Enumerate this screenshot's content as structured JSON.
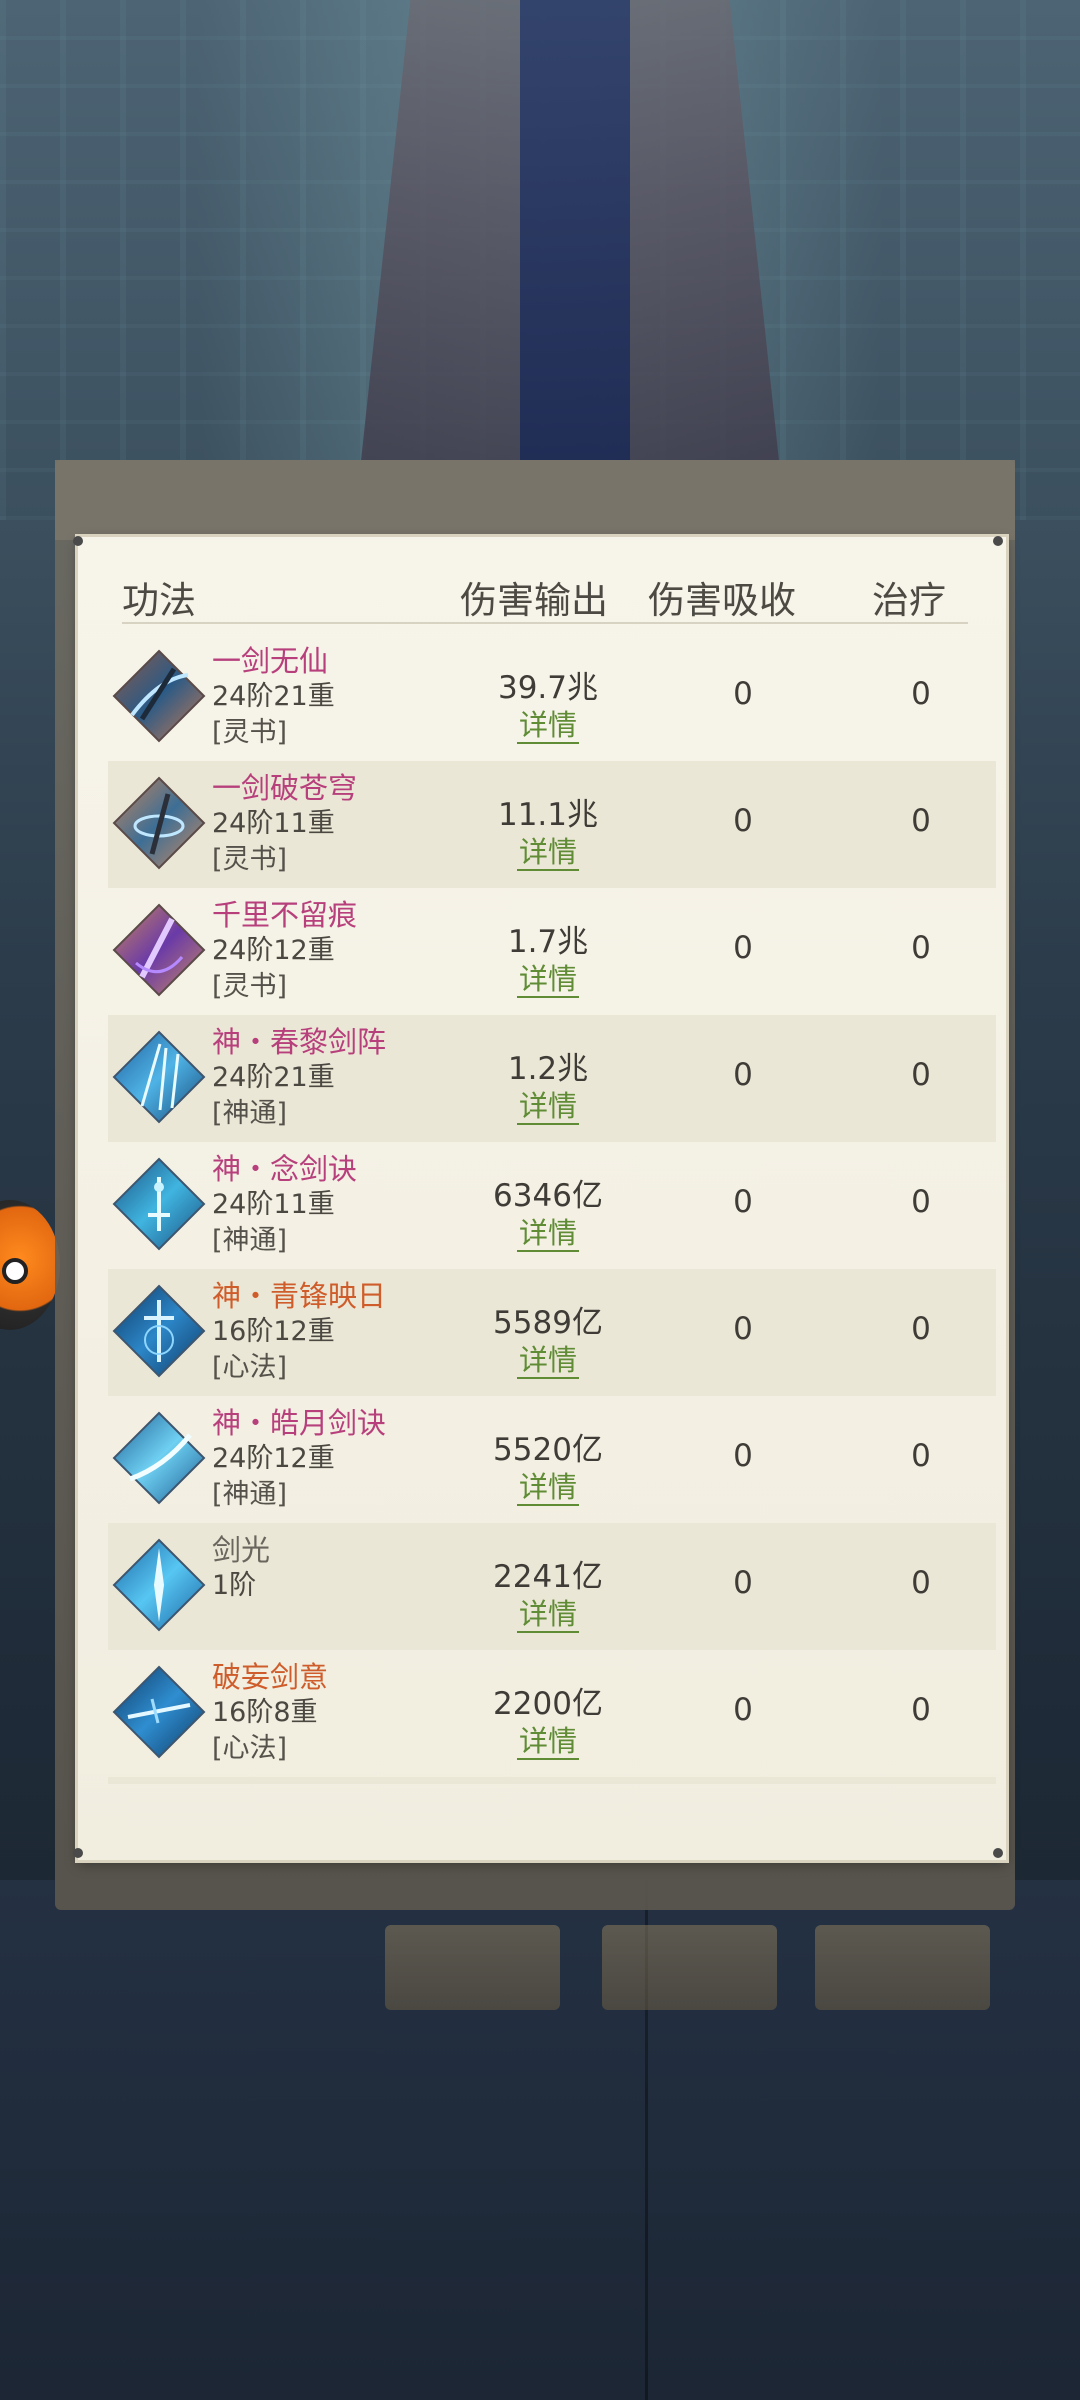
{
  "header": {
    "col_skill": "功法",
    "col_damage": "伤害输出",
    "col_absorb": "伤害吸收",
    "col_heal": "治疗"
  },
  "rows": [
    {
      "name": "一剑无仙",
      "tier": "24阶21重",
      "category": "[灵书]",
      "damage": "39.7兆",
      "detail": "详情",
      "absorb": "0",
      "heal": "0",
      "icon": "sword-slash-icon"
    },
    {
      "name": "一剑破苍穹",
      "tier": "24阶11重",
      "category": "[灵书]",
      "damage": "11.1兆",
      "detail": "详情",
      "absorb": "0",
      "heal": "0",
      "icon": "sword-vortex-icon"
    },
    {
      "name": "千里不留痕",
      "tier": "24阶12重",
      "category": "[灵书]",
      "damage": "1.7兆",
      "detail": "详情",
      "absorb": "0",
      "heal": "0",
      "icon": "purple-blade-icon"
    },
    {
      "name": "神・春黎剑阵",
      "tier": "24阶21重",
      "category": "[神通]",
      "damage": "1.2兆",
      "detail": "详情",
      "absorb": "0",
      "heal": "0",
      "icon": "sword-array-icon"
    },
    {
      "name": "神・念剑诀",
      "tier": "24阶11重",
      "category": "[神通]",
      "damage": "6346亿",
      "detail": "详情",
      "absorb": "0",
      "heal": "0",
      "icon": "sword-rain-icon"
    },
    {
      "name": "神・青锋映日",
      "tier": "16阶12重",
      "category": "[心法]",
      "damage": "5589亿",
      "detail": "详情",
      "absorb": "0",
      "heal": "0",
      "icon": "sword-crest-icon"
    },
    {
      "name": "神・皓月剑诀",
      "tier": "24阶12重",
      "category": "[神通]",
      "damage": "5520亿",
      "detail": "详情",
      "absorb": "0",
      "heal": "0",
      "icon": "crescent-slash-icon"
    },
    {
      "name": "剑光",
      "tier": "1阶",
      "category": "",
      "damage": "2241亿",
      "detail": "详情",
      "absorb": "0",
      "heal": "0",
      "icon": "sword-light-icon"
    },
    {
      "name": "破妄剑意",
      "tier": "16阶8重",
      "category": "[心法]",
      "damage": "2200亿",
      "detail": "详情",
      "absorb": "0",
      "heal": "0",
      "icon": "sword-intent-icon"
    }
  ],
  "colors": {
    "name_pink": "#b7407c",
    "name_orange": "#cf5d2b",
    "name_gray": "#6a665e",
    "detail_green": "#5f8c35",
    "panel_bg": "#f4f1e6",
    "row_alt": "#ebe7d6"
  }
}
